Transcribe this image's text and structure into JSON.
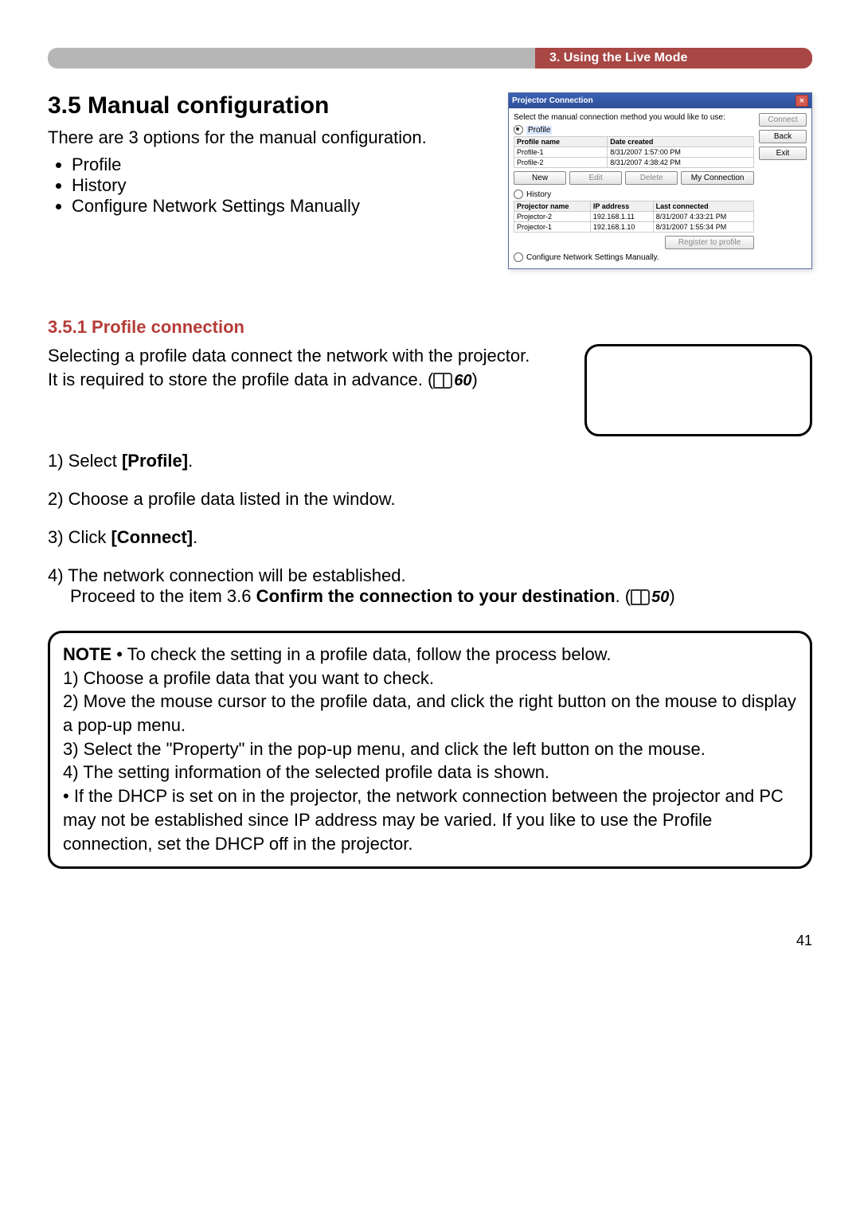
{
  "header": {
    "breadcrumb": "3. Using the Live Mode"
  },
  "section": {
    "title": "3.5 Manual configuration",
    "intro": "There are 3 options for the manual configuration.",
    "bullets": [
      "Profile",
      "History",
      "Configure Network Settings Manually"
    ]
  },
  "dialog": {
    "title": "Projector Connection",
    "instruction": "Select the manual connection method you would like to use:",
    "radio": {
      "profile": "Profile",
      "history": "History",
      "manual": "Configure Network Settings Manually."
    },
    "profile_table": {
      "headers": [
        "Profile name",
        "Date created"
      ],
      "rows": [
        [
          "Profile-1",
          "8/31/2007 1:57:00 PM"
        ],
        [
          "Profile-2",
          "8/31/2007 4:38:42 PM"
        ]
      ]
    },
    "profile_buttons": {
      "new": "New",
      "edit": "Edit",
      "delete": "Delete",
      "myconn": "My Connection"
    },
    "history_table": {
      "headers": [
        "Projector name",
        "IP address",
        "Last connected"
      ],
      "rows": [
        [
          "Projector-2",
          "192.168.1.11",
          "8/31/2007 4:33:21 PM"
        ],
        [
          "Projector-1",
          "192.168.1.10",
          "8/31/2007 1:55:34 PM"
        ]
      ]
    },
    "register_btn": "Register to profile",
    "side_buttons": {
      "connect": "Connect",
      "back": "Back",
      "exit": "Exit"
    }
  },
  "subsection": {
    "heading": "3.5.1 Profile connection",
    "para1a": "Selecting a profile data connect the network with the projector.",
    "para1b": "It is required to store the profile data in advance. (",
    "ref1": "60",
    "para1c": ")",
    "step1a": "1) Select ",
    "step1b": "[Profile]",
    "step1c": ".",
    "step2": "2) Choose a profile data listed in the window.",
    "step3a": "3) Click ",
    "step3b": "[Connect]",
    "step3c": ".",
    "step4a": "4) The network connection will be established.",
    "step4b": "Proceed to the item 3.6 ",
    "step4c": "Confirm the connection to your destination",
    "step4d": ". (",
    "ref2": "50",
    "step4e": ")"
  },
  "note": {
    "label": "NOTE",
    "intro": "• To check the setting in a profile data, follow the process below.",
    "n1": "1) Choose a profile data that you want to check.",
    "n2": "2) Move the mouse cursor to the profile data, and click the right button on the mouse to display a pop-up menu.",
    "n3": "3) Select the \"Property\" in the pop-up menu, and click the left button on the mouse.",
    "n4": "4) The setting information of the selected profile data is shown.",
    "extra": "• If the DHCP is set on in the projector, the network connection between the projector and PC may not be established since IP address may be varied. If you like to use the Profile connection, set the DHCP off in the projector."
  },
  "page_number": "41"
}
